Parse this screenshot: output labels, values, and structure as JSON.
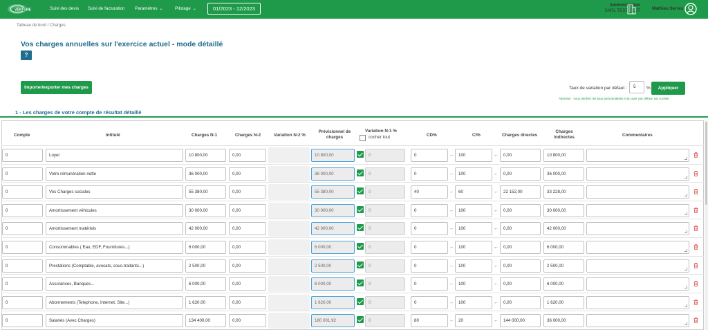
{
  "topbar": {
    "logo_label": "VENTURE",
    "nav": [
      {
        "label": "Suivi des devis",
        "dropdown": false
      },
      {
        "label": "Suivi de facturation",
        "dropdown": false
      },
      {
        "label": "Paramètres",
        "dropdown": true
      },
      {
        "label": "Pilotage",
        "dropdown": true
      }
    ],
    "period": "01/2023 - 12/2023",
    "admin_title": "Administration",
    "company": "SARL TEST TEST",
    "user_name": "Mathieu Serres",
    "icons": {
      "company": "building-icon",
      "user": "user-avatar-icon"
    }
  },
  "breadcrumb": "Tableau de bord / Charges",
  "page_title": "Vos charges annuelles sur l'exercice actuel - mode détaillé",
  "help_button": "?",
  "import_button": "Importer/exporter mes charges",
  "variation": {
    "label": "Taux de variation par défaut :",
    "value": "5",
    "unit": "%",
    "apply_button": "Appliquer",
    "warning": "Attention : vous perdrez les taux personnalisés si la case 'par défaut' est cochée"
  },
  "section_title": "1 - Les charges de votre compte de résultat détaillé",
  "table": {
    "headers": {
      "compte": "Compte",
      "intitule": "Intitulé",
      "n1": "Charges N-1",
      "n2": "Charges N-2",
      "var_n2": "Variation N-2 %",
      "prev_line1": "Prévisionnel de",
      "prev_line2": "charges",
      "var_n1": "Variation N-1 %",
      "cocher": "cocher tout",
      "cd": "CD%",
      "ci": "CI%",
      "directes": "Charges directes",
      "indirectes_line1": "Charges",
      "indirectes_line2": "indirectes",
      "commentaires": "Commentaires"
    },
    "rows": [
      {
        "compte": "0",
        "intitule": "Loyer",
        "n1": "10 800,00",
        "n2": "0,00",
        "prev": "10 800,00",
        "var": "0",
        "cd": "0",
        "ci": "100",
        "directes": "0,00",
        "indirectes": "10 800,00"
      },
      {
        "compte": "0",
        "intitule": "Votre rémunération nette",
        "n1": "36 000,00",
        "n2": "0,00",
        "prev": "36 000,00",
        "var": "0",
        "cd": "0",
        "ci": "100",
        "directes": "0,00",
        "indirectes": "36 000,00"
      },
      {
        "compte": "0",
        "intitule": "Vos Charges sociales",
        "n1": "55 380,00",
        "n2": "0,00",
        "prev": "55 380,00",
        "var": "0",
        "cd": "40",
        "ci": "60",
        "directes": "22 152,00",
        "indirectes": "33 228,00"
      },
      {
        "compte": "0",
        "intitule": "Amortissement véhicules",
        "n1": "30 000,00",
        "n2": "0,00",
        "prev": "30 000,00",
        "var": "0",
        "cd": "0",
        "ci": "100",
        "directes": "0,00",
        "indirectes": "30 000,00"
      },
      {
        "compte": "0",
        "intitule": "Amortissement matériels",
        "n1": "42 000,00",
        "n2": "0,00",
        "prev": "42 000,00",
        "var": "0",
        "cd": "0",
        "ci": "100",
        "directes": "0,00",
        "indirectes": "42 000,00"
      },
      {
        "compte": "0",
        "intitule": "Consommables ( Eau, EDF, Fournitures...)",
        "n1": "6 000,00",
        "n2": "0,00",
        "prev": "6 000,00",
        "var": "0",
        "cd": "0",
        "ci": "100",
        "directes": "0,00",
        "indirectes": "6 000,00"
      },
      {
        "compte": "0",
        "intitule": "Prestations (Comptable, avocats, sous-traitants...)",
        "n1": "2 500,00",
        "n2": "0,00",
        "prev": "2 500,00",
        "var": "0",
        "cd": "0",
        "ci": "100",
        "directes": "0,00",
        "indirectes": "2 500,00"
      },
      {
        "compte": "0",
        "intitule": "Assurances, Banques...",
        "n1": "6 000,00",
        "n2": "0,00",
        "prev": "6 000,00",
        "var": "0",
        "cd": "0",
        "ci": "100",
        "directes": "0,00",
        "indirectes": "6 000,00"
      },
      {
        "compte": "0",
        "intitule": "Abonnements (Telephone, Internet, Site...)",
        "n1": "1 620,00",
        "n2": "0,00",
        "prev": "1 620,00",
        "var": "0",
        "cd": "0",
        "ci": "100",
        "directes": "0,00",
        "indirectes": "1 620,00"
      },
      {
        "compte": "0",
        "intitule": "Salariés (Avec Charges)",
        "n1": "134 400,00",
        "n2": "0,00",
        "prev": "180 001,92",
        "var": "0",
        "cd": "80",
        "ci": "20",
        "directes": "144 000,00",
        "indirectes": "36 000,00"
      }
    ]
  },
  "colors": {
    "green": "#1e9a4a",
    "blue_title": "#1d6b8c",
    "prev_border": "#4aa3d8",
    "trash": "#d9534f"
  }
}
